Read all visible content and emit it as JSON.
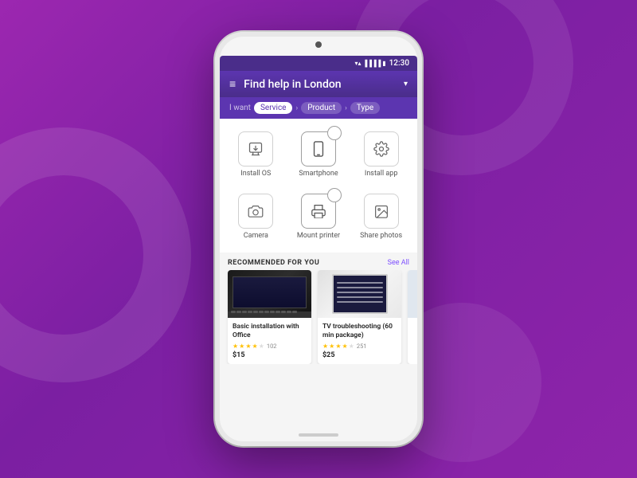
{
  "background": {
    "color": "#8e24aa"
  },
  "status_bar": {
    "time": "12:30"
  },
  "header": {
    "menu_label": "≡",
    "title": "Find help in London",
    "dropdown_arrow": "▾"
  },
  "breadcrumb": {
    "i_want": "I want",
    "items": [
      {
        "label": "Service",
        "active": true
      },
      {
        "label": "Product",
        "active": false
      },
      {
        "label": "Type",
        "active": false
      }
    ]
  },
  "services": {
    "items": [
      {
        "label": "Install OS",
        "icon": "⬇",
        "selected": false
      },
      {
        "label": "Smartphone",
        "icon": "📱",
        "selected": true
      },
      {
        "label": "Install app",
        "icon": "⚙",
        "selected": false
      },
      {
        "label": "Camera",
        "icon": "📷",
        "selected": false
      },
      {
        "label": "Mount printer",
        "icon": "🖨",
        "selected": false
      },
      {
        "label": "Share photos",
        "icon": "🖼",
        "selected": false
      }
    ]
  },
  "recommended": {
    "section_title": "RECOMMENDED FOR YOU",
    "see_all_label": "See All",
    "cards": [
      {
        "title": "Basic installation with Office",
        "rating": 4,
        "review_count": "102",
        "price": "$15",
        "image_type": "laptop"
      },
      {
        "title": "TV troubleshooting (60 min package)",
        "rating": 4,
        "review_count": "251",
        "price": "$25",
        "image_type": "tablet"
      }
    ]
  }
}
